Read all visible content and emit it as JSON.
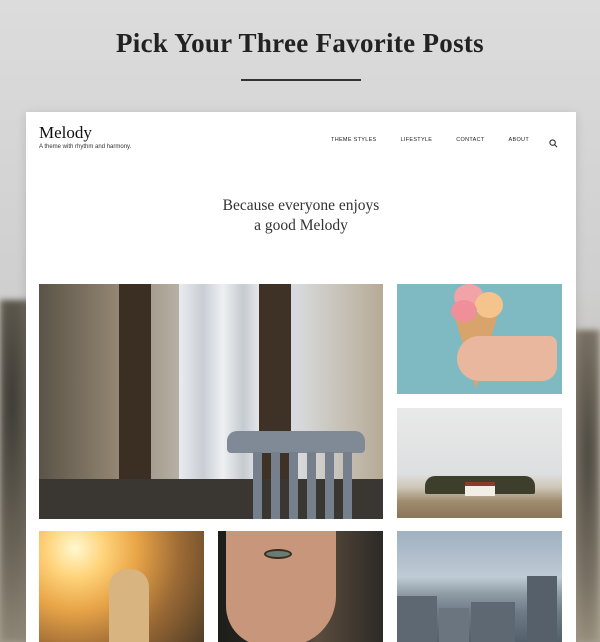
{
  "page": {
    "title": "Pick Your Three Favorite Posts"
  },
  "site": {
    "brand": "Melody",
    "tagline": "A theme with rhythm and harmony.",
    "nav": [
      {
        "label": "Theme Styles"
      },
      {
        "label": "Lifestyle"
      },
      {
        "label": "Contact"
      },
      {
        "label": "About"
      }
    ],
    "search_icon": "search-icon",
    "headline_line1": "Because everyone enjoys",
    "headline_line2": "a good Melody"
  },
  "posts": [
    {
      "image": "window-chair-photo"
    },
    {
      "image": "ice-cream-cone-photo"
    },
    {
      "image": "farmhouse-landscape-photo"
    },
    {
      "image": "sunset-girl-photo"
    },
    {
      "image": "freckled-face-photo"
    },
    {
      "image": "paris-rooftops-photo"
    }
  ],
  "colors": {
    "card_bg": "#ffffff",
    "text": "#222222",
    "backdrop": "#cfcfcf"
  }
}
